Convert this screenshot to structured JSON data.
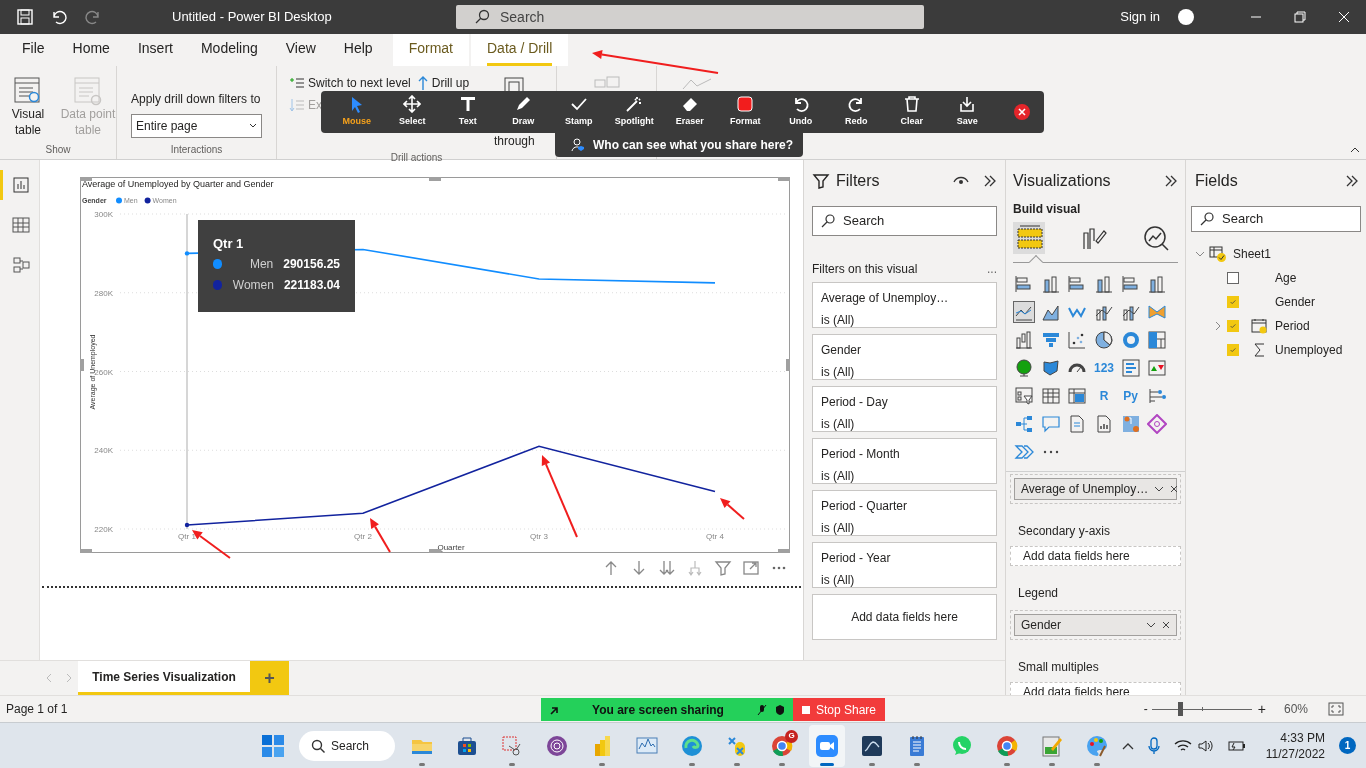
{
  "title_bar": {
    "title": "Untitled - Power BI Desktop",
    "search_placeholder": "Search",
    "sign_in": "Sign in"
  },
  "ribbon_tabs": [
    {
      "label": "File",
      "selected": false,
      "contextual": false
    },
    {
      "label": "Home",
      "selected": false,
      "contextual": false
    },
    {
      "label": "Insert",
      "selected": false,
      "contextual": false
    },
    {
      "label": "Modeling",
      "selected": false,
      "contextual": false
    },
    {
      "label": "View",
      "selected": false,
      "contextual": false
    },
    {
      "label": "Help",
      "selected": false,
      "contextual": false
    },
    {
      "label": "Format",
      "selected": false,
      "contextual": true
    },
    {
      "label": "Data / Drill",
      "selected": true,
      "contextual": true
    }
  ],
  "ribbon": {
    "show_group": {
      "label": "Show",
      "buttons": [
        {
          "label": "Visual table",
          "disabled": false
        },
        {
          "label": "Data point table",
          "disabled": true
        }
      ]
    },
    "interactions_group": {
      "label": "Interactions",
      "caption": "Apply drill down filters to",
      "select_value": "Entire page"
    },
    "drill_group": {
      "label": "Drill actions",
      "actions": [
        {
          "label": "Switch to next level",
          "disabled": false
        },
        {
          "label": "Drill up",
          "disabled": false
        },
        {
          "label": "Ex",
          "disabled": true
        }
      ],
      "drill_through": "through"
    }
  },
  "annotation_toolbar": {
    "tools": [
      {
        "label": "Mouse",
        "selected": true
      },
      {
        "label": "Select",
        "selected": false
      },
      {
        "label": "Text",
        "selected": false
      },
      {
        "label": "Draw",
        "selected": false
      },
      {
        "label": "Stamp",
        "selected": false
      },
      {
        "label": "Spotlight",
        "selected": false
      },
      {
        "label": "Eraser",
        "selected": false
      },
      {
        "label": "Format",
        "selected": false
      },
      {
        "label": "Undo",
        "selected": false
      },
      {
        "label": "Redo",
        "selected": false
      },
      {
        "label": "Clear",
        "selected": false
      },
      {
        "label": "Save",
        "selected": false
      }
    ],
    "share_hint": "Who can see what you share here?"
  },
  "left_nav": [
    {
      "kind": "report",
      "selected": true
    },
    {
      "kind": "data",
      "selected": false
    },
    {
      "kind": "model",
      "selected": false
    }
  ],
  "visual": {
    "chart_data": {
      "type": "line",
      "grid": true,
      "legend": {
        "title": "Gender"
      },
      "ref_lines": [
        {
          "axis": "x",
          "value": "Qtr 1"
        }
      ],
      "title": "Average of Unemployed by Quarter and Gender",
      "xlabel": "Quarter",
      "ylabel": "Average of Unemployed",
      "categories": [
        "Qtr 1",
        "Qtr 2",
        "Qtr 3",
        "Qtr 4"
      ],
      "series": [
        {
          "name": "Men",
          "color": "#118dff",
          "values": [
            290000,
            291000,
            283500,
            282500
          ]
        },
        {
          "name": "Women",
          "color": "#12239e",
          "values": [
            221000,
            224000,
            241000,
            229500
          ]
        }
      ],
      "ylim": [
        220000,
        300000
      ],
      "yticks": [
        {
          "value": 220000,
          "label": "220K"
        },
        {
          "value": 240000,
          "label": "240K"
        },
        {
          "value": 260000,
          "label": "260K"
        },
        {
          "value": 280000,
          "label": "280K"
        },
        {
          "value": 300000,
          "label": "300K"
        }
      ]
    },
    "tooltip": {
      "title": "Qtr 1",
      "rows": [
        {
          "name": "Men",
          "value": "290156.25",
          "color": "#118dff"
        },
        {
          "name": "Women",
          "value": "221183.04",
          "color": "#12239e"
        }
      ]
    }
  },
  "filters": {
    "title": "Filters",
    "search_placeholder": "Search",
    "section": "Filters on this visual",
    "more": "...",
    "cards": [
      {
        "name": "Average of Unemploy…",
        "value": "is (All)"
      },
      {
        "name": "Gender",
        "value": "is (All)"
      },
      {
        "name": "Period - Day",
        "value": "is (All)"
      },
      {
        "name": "Period - Month",
        "value": "is (All)"
      },
      {
        "name": "Period - Quarter",
        "value": "is (All)"
      },
      {
        "name": "Period - Year",
        "value": "is (All)"
      }
    ],
    "drop_zone": "Add data fields here"
  },
  "visualizations": {
    "title": "Visualizations",
    "subtitle": "Build visual",
    "modes": [
      {
        "kind": "fields",
        "selected": true
      },
      {
        "kind": "format",
        "selected": false
      },
      {
        "kind": "analytics",
        "selected": false
      }
    ],
    "gallery": [
      {
        "selected": false
      },
      {
        "selected": false
      },
      {
        "selected": false
      },
      {
        "selected": false
      },
      {
        "selected": false
      },
      {
        "selected": false
      },
      {
        "selected": true
      },
      {
        "selected": false
      },
      {
        "selected": false
      },
      {
        "selected": false
      },
      {
        "selected": false
      },
      {
        "selected": false
      },
      {
        "selected": false
      },
      {
        "selected": false
      },
      {
        "selected": false
      },
      {
        "selected": false
      },
      {
        "selected": false
      },
      {
        "selected": false
      },
      {
        "selected": false
      },
      {
        "selected": false
      },
      {
        "selected": false
      },
      {
        "selected": false,
        "glyph": "123"
      },
      {
        "selected": false
      },
      {
        "selected": false
      },
      {
        "selected": false
      },
      {
        "selected": false
      },
      {
        "selected": false
      },
      {
        "selected": false,
        "glyph": "R"
      },
      {
        "selected": false,
        "glyph": "Py"
      },
      {
        "selected": false
      },
      {
        "selected": false
      },
      {
        "selected": false
      },
      {
        "selected": false
      },
      {
        "selected": false
      },
      {
        "selected": false
      },
      {
        "selected": false
      },
      {
        "selected": false
      }
    ],
    "wells": [
      {
        "kind": "chip",
        "label": "Average of Unemploy…"
      },
      {
        "kind": "heading",
        "label": "Secondary y-axis"
      },
      {
        "kind": "drop",
        "label": "Add data fields here"
      },
      {
        "kind": "heading",
        "label": "Legend"
      },
      {
        "kind": "chip",
        "label": "Gender"
      },
      {
        "kind": "heading",
        "label": "Small multiples"
      },
      {
        "kind": "drop",
        "label": "Add data fields here"
      }
    ]
  },
  "fields": {
    "title": "Fields",
    "search_placeholder": "Search",
    "tree": [
      {
        "label": "Sheet1",
        "kind": "table",
        "checked": true,
        "expanded": true,
        "children": [
          {
            "label": "Age",
            "kind": "text",
            "checked": false
          },
          {
            "label": "Gender",
            "kind": "text",
            "checked": true
          },
          {
            "label": "Period",
            "kind": "date",
            "checked": true,
            "expanded": false
          },
          {
            "label": "Unemployed",
            "kind": "measure",
            "checked": true
          }
        ]
      }
    ]
  },
  "page_tabs": [
    {
      "label": "Time Series Visualization",
      "selected": true
    }
  ],
  "add_page": "+",
  "status_bar": {
    "page": "Page 1 of 1",
    "zoom_out": "-",
    "zoom_in": "+",
    "zoom": {
      "level": 0.28
    },
    "zoom_reading": "60%"
  },
  "share_bar": {
    "message": "You are screen sharing",
    "stop": "Stop Share"
  },
  "taskbar": {
    "search": "Search",
    "apps": [
      {
        "kind": "folder",
        "running": true,
        "selected": false
      },
      {
        "kind": "store",
        "running": false,
        "selected": false
      },
      {
        "kind": "snip",
        "running": true,
        "selected": false
      },
      {
        "kind": "tor",
        "running": false,
        "selected": false
      },
      {
        "kind": "bars",
        "running": true,
        "selected": false
      },
      {
        "kind": "monitor",
        "running": false,
        "selected": false
      },
      {
        "kind": "edge",
        "running": true,
        "selected": false
      },
      {
        "kind": "tools",
        "running": true,
        "selected": false
      },
      {
        "kind": "chrome",
        "running": true,
        "selected": false,
        "badge": "G"
      },
      {
        "kind": "camera",
        "running": true,
        "selected": true
      },
      {
        "kind": "wave",
        "running": true,
        "selected": false
      },
      {
        "kind": "notepad",
        "running": true,
        "selected": false
      },
      {
        "kind": "chat",
        "running": false,
        "selected": false
      },
      {
        "kind": "chrome",
        "running": true,
        "selected": false
      },
      {
        "kind": "editor",
        "running": true,
        "selected": false
      },
      {
        "kind": "palette",
        "running": true,
        "selected": false
      }
    ],
    "time": "4:33 PM",
    "date": "11/27/2022",
    "notifications": "1"
  }
}
